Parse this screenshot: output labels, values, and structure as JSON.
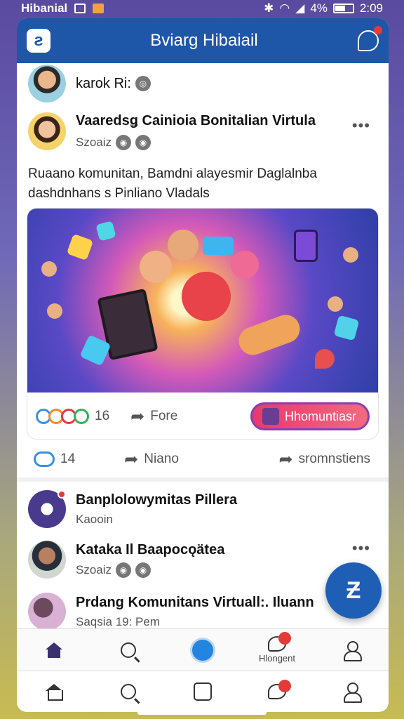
{
  "status_bar": {
    "carrier": "Hibanial",
    "battery": "4%",
    "time": "2:09"
  },
  "app_bar": {
    "title": "Bviarg Hibaiail"
  },
  "user_row": {
    "name": "karok Ri:"
  },
  "post": {
    "title": "Vaaredsǥ Cainioia Bonitalian Virtula",
    "subtitle": "Szoaiz",
    "more": "•••",
    "text_line1": "Ruaano komunitan, Bamdni alayesmir Daglalnba",
    "text_line2": "dashdnhans s Pinliano Vladals",
    "reaction_count": "16",
    "share_label": "Fore",
    "join_label": "Hhomuntiasr"
  },
  "action_row": {
    "reaction_count": "14",
    "share_label": "Niano",
    "comment_label": "sromnstiens"
  },
  "list": [
    {
      "title": "Banplolowymitas Pillera",
      "subtitle": "Kaooin"
    },
    {
      "title": "Kataka Il Baapocǫätea",
      "subtitle": "Szoaiz",
      "more": "•••"
    },
    {
      "title": "Prdang Komunitans Virtuall:. Iluann",
      "subtitle": "Saqsia 19: Pem"
    }
  ],
  "bottom_nav_1": {
    "messages_label": "Hlongent"
  },
  "colors": {
    "brand": "#1e56a8",
    "accent": "#2485e0",
    "cta": "#e8396b",
    "badge": "#e53a3a"
  }
}
